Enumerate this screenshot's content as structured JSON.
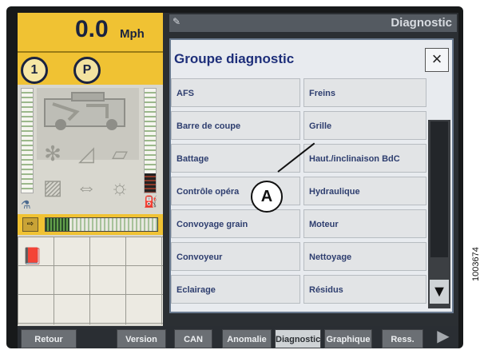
{
  "status": {
    "speed_value": "0.0",
    "speed_unit": "Mph",
    "gear": "1",
    "park": "P"
  },
  "header": {
    "title": "Diagnostic"
  },
  "dialog": {
    "title": "Groupe diagnostic",
    "close_symbol": "×",
    "left_column": [
      "AFS",
      "Barre de coupe",
      "Battage",
      "Contrôle opéra",
      "Convoyage grain",
      "Convoyeur",
      "Eclairage"
    ],
    "right_column": [
      "Freins",
      "Grille",
      "Haut./inclinaison BdC",
      "Hydraulique",
      "Moteur",
      "Nettoyage",
      "Résidus"
    ],
    "scroll_down_symbol": "▼"
  },
  "callout": {
    "label": "A"
  },
  "tabs": [
    "Retour",
    "Version",
    "CAN",
    "Anomalie",
    "Diagnostic",
    "Graphique",
    "Ress."
  ],
  "figure_id": "1003674",
  "icons": {
    "next_arrow": "right-arrow-icon"
  },
  "colors": {
    "status_yellow": "#f0c233",
    "dialog_title": "#1e2f7a",
    "button_text": "#2e3e6f"
  }
}
